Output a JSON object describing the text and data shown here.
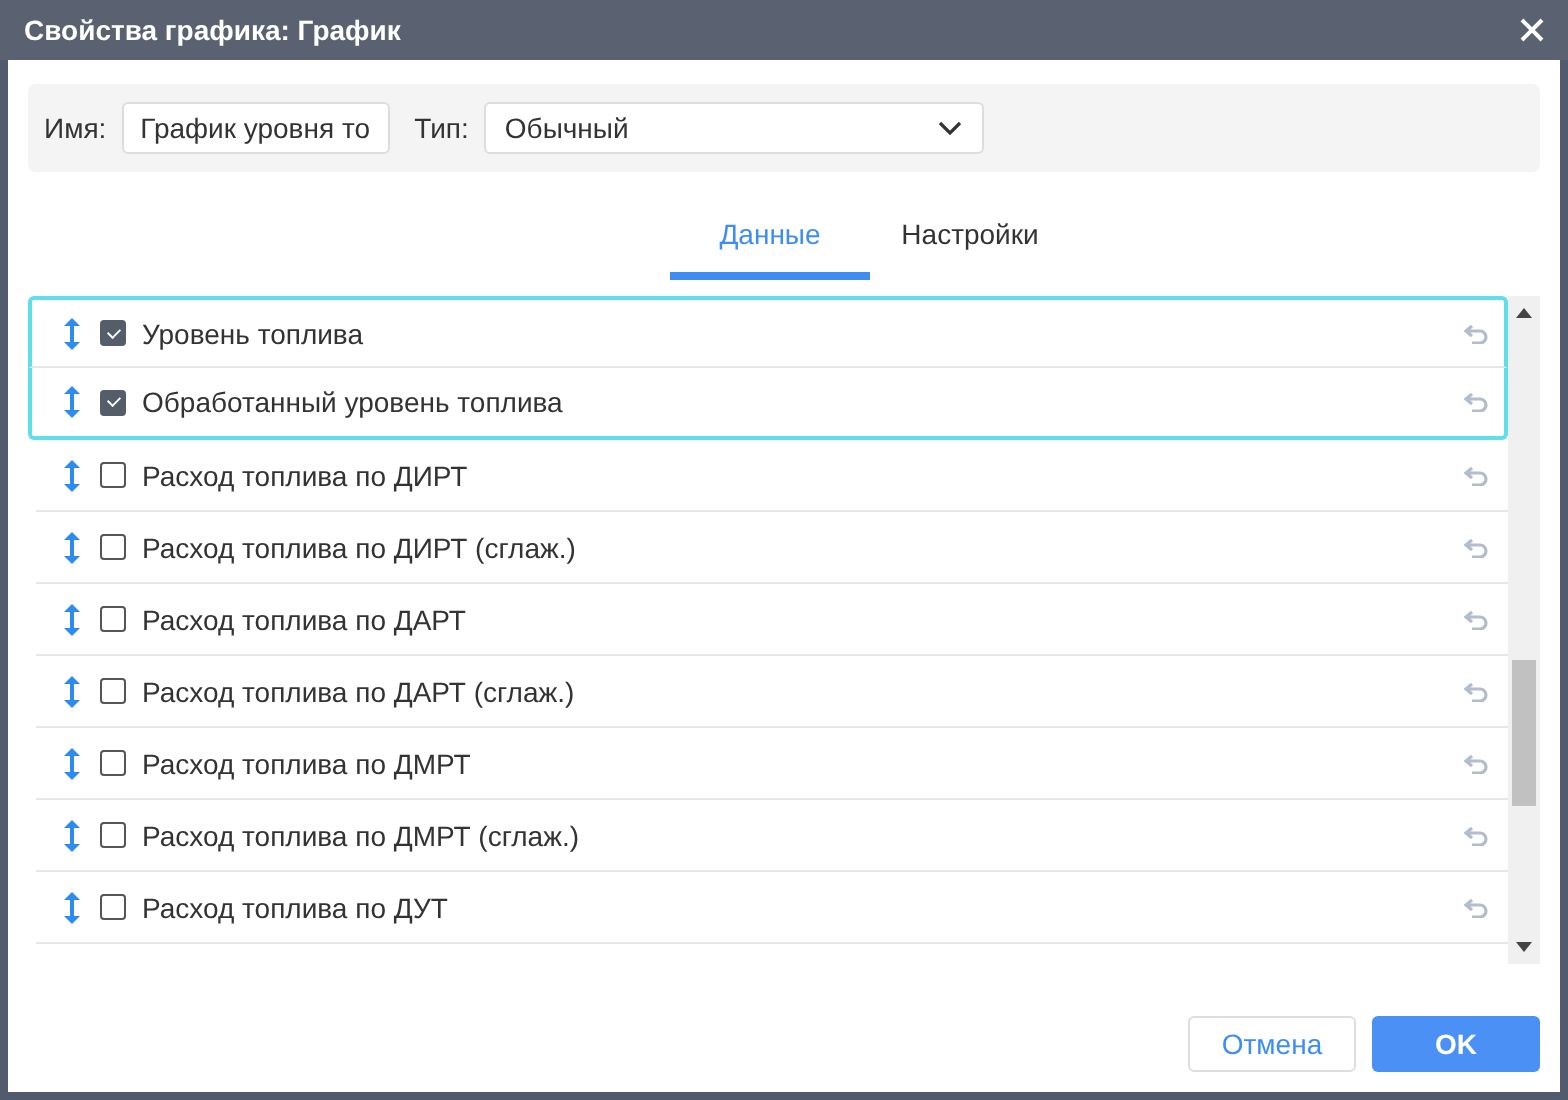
{
  "window": {
    "title": "Свойства графика: График"
  },
  "form": {
    "name_label": "Имя:",
    "name_value": "График уровня то",
    "type_label": "Тип:",
    "type_value": "Обычный"
  },
  "tabs": [
    {
      "label": "Данные",
      "selected": true
    },
    {
      "label": "Настройки",
      "selected": false
    }
  ],
  "rows": [
    {
      "label": "Уровень топлива",
      "checked": true,
      "selected": true
    },
    {
      "label": "Обработанный уровень топлива",
      "checked": true,
      "selected": true
    },
    {
      "label": "Расход топлива по ДИРТ",
      "checked": false,
      "selected": false
    },
    {
      "label": "Расход топлива по ДИРТ (сглаж.)",
      "checked": false,
      "selected": false
    },
    {
      "label": "Расход топлива по ДАРТ",
      "checked": false,
      "selected": false
    },
    {
      "label": "Расход топлива по ДАРТ (сглаж.)",
      "checked": false,
      "selected": false
    },
    {
      "label": "Расход топлива по ДМРТ",
      "checked": false,
      "selected": false
    },
    {
      "label": "Расход топлива по ДМРТ (сглаж.)",
      "checked": false,
      "selected": false
    },
    {
      "label": "Расход топлива по ДУТ",
      "checked": false,
      "selected": false
    }
  ],
  "buttons": [
    {
      "label": "Отмена",
      "kind": "secondary"
    },
    {
      "label": "OK",
      "kind": "primary"
    }
  ]
}
